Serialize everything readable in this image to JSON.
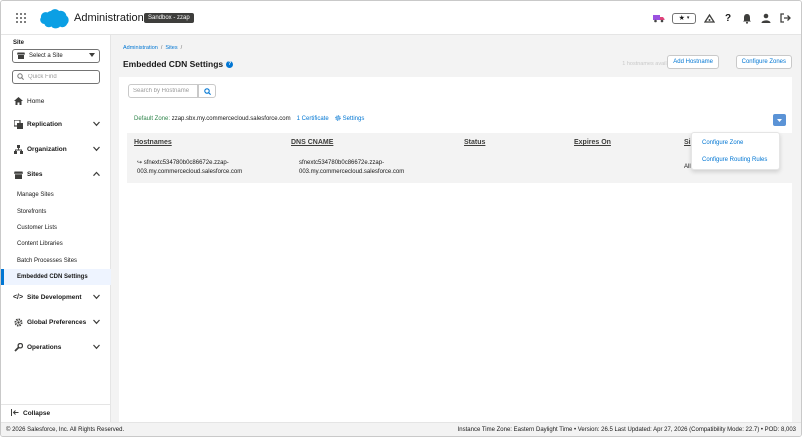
{
  "header": {
    "app_title": "Administration",
    "sandbox_badge": "Sandbox - zzap",
    "colors": {
      "brand": "#0b9fe4",
      "badge_bg": "#3e3e3c"
    }
  },
  "sidebar": {
    "site_label": "Site",
    "site_select_value": "Select a Site",
    "quick_find_placeholder": "Quick Find",
    "home": "Home",
    "groups": {
      "replication": "Replication",
      "organization": "Organization",
      "sites": "Sites",
      "site_development": "Site Development",
      "global_preferences": "Global Preferences",
      "operations": "Operations"
    },
    "sites_items": [
      "Manage Sites",
      "Storefronts",
      "Customer Lists",
      "Content Libraries",
      "Batch Processes Sites",
      "Embedded CDN Settings"
    ],
    "collapse": "Collapse"
  },
  "page": {
    "breadcrumbs": [
      "Administration",
      "Sites"
    ],
    "title": "Embedded CDN Settings",
    "hostnames_available": "1 hostnames available",
    "add_hostname": "Add Hostname",
    "configure_zones": "Configure Zones"
  },
  "content": {
    "search_placeholder": "Search by Hostname",
    "default_zone_label": "Default Zone:",
    "default_zone_value": "zzap.sbx.my.commercecloud.salesforce.com",
    "certificate_link": "1 Certificate",
    "settings_link": "Settings",
    "table": {
      "headers": [
        "Hostnames",
        "DNS CNAME",
        "Status",
        "Expires On",
        "Si"
      ],
      "row": {
        "hostname_line1": "sfnextc534780b0c86672e.zzap-",
        "hostname_line2": "003.my.commercecloud.salesforce.com",
        "cname_line1": "sfnextc534780b0c86672e.zzap-",
        "cname_line2": "003.my.commercecloud.salesforce.com",
        "site": "All"
      }
    },
    "menu": [
      "Configure Zone",
      "Configure Routing Rules"
    ]
  },
  "footer": {
    "copyright": "© 2026 Salesforce, Inc. All Rights Reserved.",
    "info": "Instance Time Zone: Eastern Daylight Time  •  Version: 26.5 Last Updated: Apr 27, 2026 (Compatibility Mode: 22.7)  •  POD: 8,003"
  }
}
